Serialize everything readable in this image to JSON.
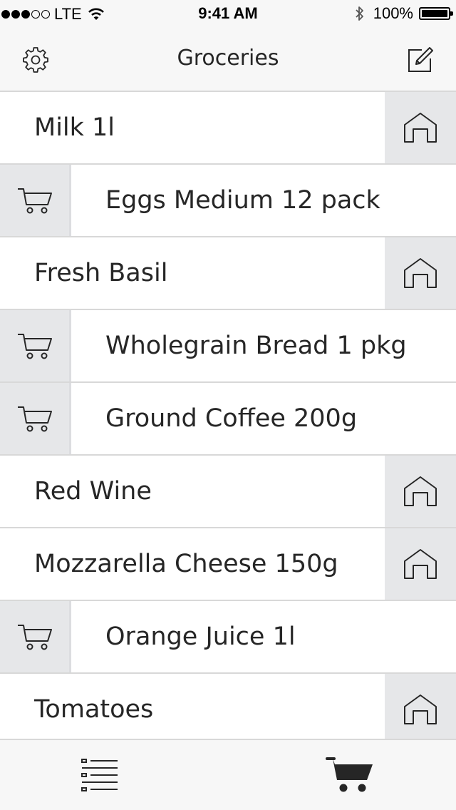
{
  "status_bar": {
    "carrier": "LTE",
    "time": "9:41 AM",
    "battery_percent": "100%",
    "signal_bars_filled": 3,
    "signal_bars_total": 5
  },
  "nav": {
    "title": "Groceries",
    "left_icon": "gear-icon",
    "right_icon": "compose-icon"
  },
  "items": [
    {
      "label": "Milk 1l",
      "action": "home-icon"
    },
    {
      "label": "Eggs Medium 12 pack",
      "action": "cart-icon"
    },
    {
      "label": "Fresh Basil",
      "action": "home-icon"
    },
    {
      "label": "Wholegrain Bread 1 pkg",
      "action": "cart-icon"
    },
    {
      "label": "Ground Coffee 200g",
      "action": "cart-icon"
    },
    {
      "label": "Red Wine",
      "action": "home-icon"
    },
    {
      "label": "Mozzarella Cheese 150g",
      "action": "home-icon"
    },
    {
      "label": "Orange Juice 1l",
      "action": "cart-icon"
    },
    {
      "label": "Tomatoes",
      "action": "home-icon"
    }
  ],
  "tab_bar": {
    "tabs": [
      {
        "icon": "list-icon",
        "selected": false
      },
      {
        "icon": "cart-filled-icon",
        "selected": true
      }
    ]
  },
  "colors": {
    "bar_background": "#f7f7f7",
    "action_cell": "#e6e7e9",
    "divider": "#d8d8d8",
    "text": "#262626"
  }
}
